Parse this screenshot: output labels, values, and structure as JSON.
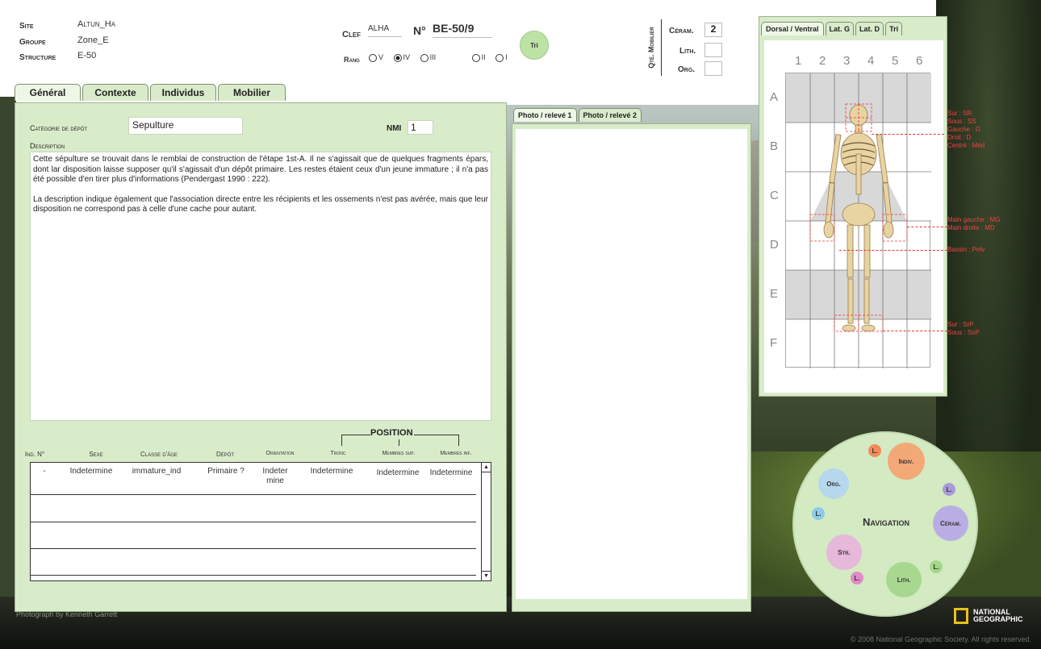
{
  "header": {
    "site_label": "Site",
    "site_value": "Altun_Ha",
    "groupe_label": "Groupe",
    "groupe_value": "Zone_E",
    "structure_label": "Structure",
    "structure_value": "E-50",
    "clef_label": "Clef",
    "clef_value": "ALHA",
    "no_label": "N°",
    "no_value": "BE-50/9",
    "tri_label": "Tri",
    "rang_label": "Rang",
    "rang_options": [
      "V",
      "IV",
      "III",
      "II",
      "I"
    ],
    "rang_selected": "IV",
    "qte_label": "Qté. Mobilier",
    "ceram_label": "Céram.",
    "ceram_value": "2",
    "lith_label": "Lith.",
    "lith_value": "",
    "org_label": "Org.",
    "org_value": ""
  },
  "tabs": [
    "Général",
    "Contexte",
    "Individus",
    "Mobilier"
  ],
  "general": {
    "categorie_label": "Catégorie de dépôt",
    "categorie_value": "Sepulture",
    "nmi_label": "NMI",
    "nmi_value": "1",
    "description_label": "Description",
    "description_p1": "Cette sépulture se trouvait dans le remblai de construction de l'étape 1st-A. Il ne s'agissait que de quelques fragments épars, dont lar disposition laisse supposer qu'il s'agissait d'un dépôt primaire. Les restes étaient ceux d'un jeune immature ; il n'a pas été possible d'en tirer plus d'informations (Pendergast 1990 : 222).",
    "description_p2": "La description indique également que l'association directe entre les récipients et les ossements n'est pas avérée, mais que leur disposition ne correspond pas à celle d'une cache pour autant."
  },
  "individus_table": {
    "position_label": "POSITION",
    "columns": [
      "Ind. N°",
      "Sexe",
      "Classe d'âge",
      "Dépôt",
      "Orientation",
      "Tronc",
      "Membres sup.",
      "Membres inf."
    ],
    "rows": [
      [
        "-",
        "Indetermine",
        "immature_ind",
        "Primaire ?",
        "Indeter mine",
        "Indetermine",
        "Indetermine",
        "Indetermine"
      ]
    ]
  },
  "photo_tabs": [
    "Photo / relevé 1",
    "Photo / relevé 2"
  ],
  "skeleton_tabs": [
    "Dorsal / Ventral",
    "Lat. G",
    "Lat. D",
    "Tri"
  ],
  "grid": {
    "cols": [
      "1",
      "2",
      "3",
      "4",
      "5",
      "6"
    ],
    "rows": [
      "A",
      "B",
      "C",
      "D",
      "E",
      "F"
    ]
  },
  "legend": {
    "head": [
      "Sur : SR",
      "Sous : SS",
      "Gauche : G",
      "Droit : D",
      "Centré : Méd"
    ],
    "hands": [
      "Main gauche : MG",
      "Main droite : MD"
    ],
    "pelvis": "Bassin : Pelv",
    "feet": [
      "Sur : SrP",
      "Sous : SsP"
    ]
  },
  "navigation": {
    "title": "Navigation",
    "indiv": "Indiv.",
    "org": "Org.",
    "ceram": "Céram.",
    "str": "Str.",
    "lith": "Lith.",
    "l": "L."
  },
  "footer": {
    "credit": "Photograph by Kenneth Garrett",
    "brand": "NATIONAL GEOGRAPHIC",
    "copyright": "© 2008 National Geographic Society. All rights reserved."
  },
  "colors": {
    "panel_green": "#d9ecca",
    "legend_red": "#e44444",
    "ng_yellow": "#e8c11b"
  }
}
